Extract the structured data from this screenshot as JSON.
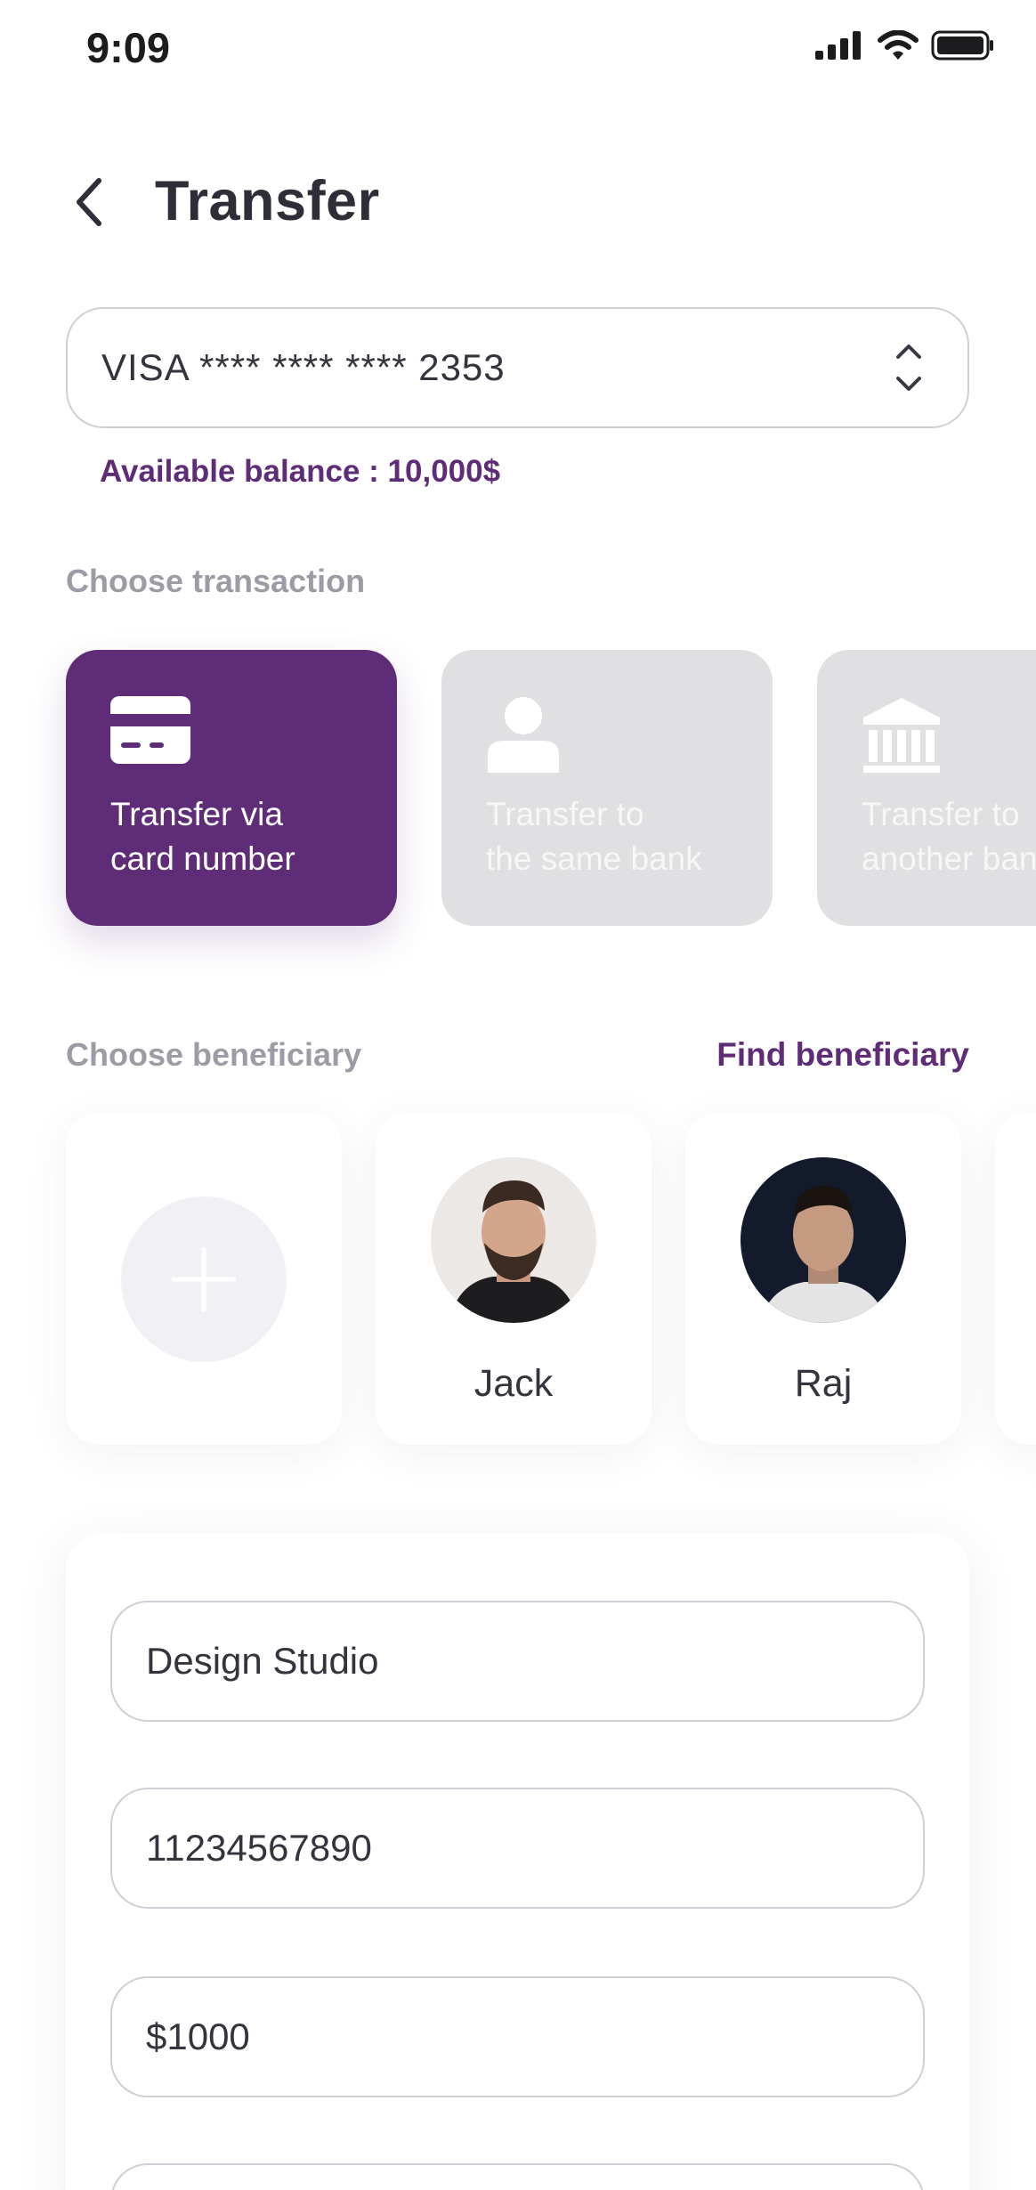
{
  "status_bar": {
    "time": "9:09"
  },
  "header": {
    "title": "Transfer"
  },
  "card_select": {
    "value": "VISA **** **** **** 2353"
  },
  "balance_text": "Available balance : 10,000$",
  "transaction": {
    "label": "Choose transaction",
    "options": [
      {
        "label": "Transfer via\ncard number",
        "icon": "credit-card-icon",
        "selected": true
      },
      {
        "label": "Transfer to\nthe same bank",
        "icon": "person-icon",
        "selected": false
      },
      {
        "label": "Transfer to\nanother bank",
        "icon": "bank-icon",
        "selected": false
      }
    ]
  },
  "beneficiary": {
    "label": "Choose beneficiary",
    "find_link": "Find beneficiary",
    "items": [
      {
        "name": "Jack"
      },
      {
        "name": "Raj"
      }
    ]
  },
  "form": {
    "name_value": "Design Studio",
    "account_value": "11234567890",
    "amount_value": "$1000"
  },
  "colors": {
    "accent": "#5f2d77",
    "tile_inactive": "#e0e0e2",
    "muted_text": "#9c9ca6"
  }
}
